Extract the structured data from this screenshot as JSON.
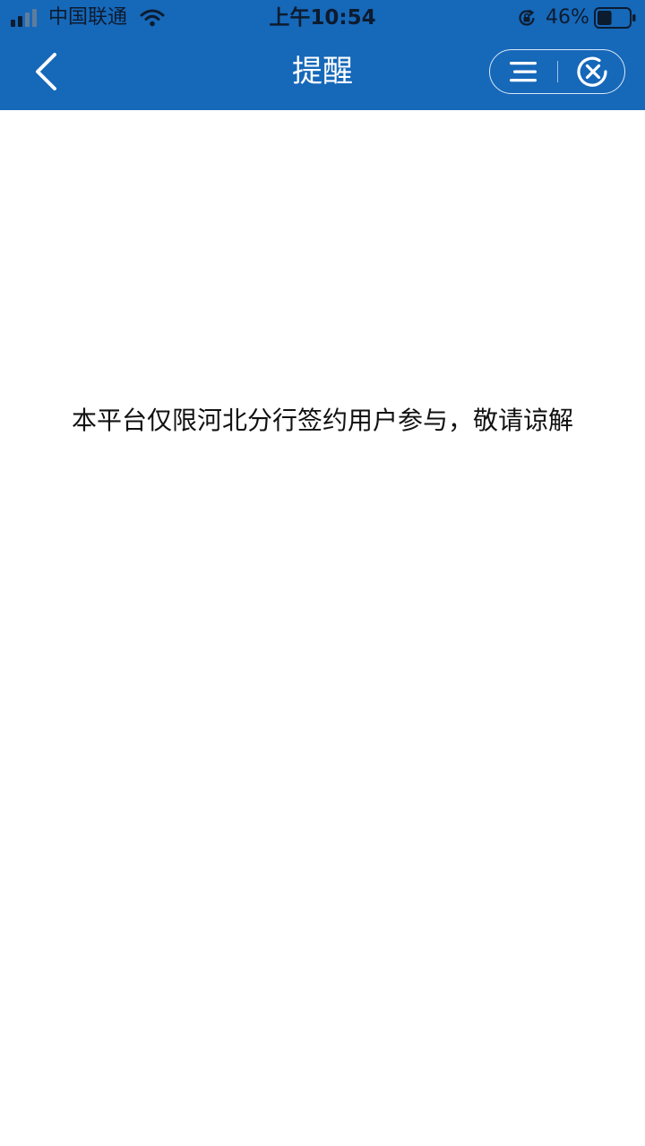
{
  "status_bar": {
    "carrier": "中国联通",
    "time": "上午10:54",
    "battery_percent": "46%",
    "battery_level": 0.46,
    "icons": [
      "signal-icon",
      "wifi-icon",
      "rotation-lock-icon",
      "battery-icon"
    ]
  },
  "nav": {
    "title": "提醒",
    "back_icon": "chevron-left-icon",
    "menu_icon": "menu-icon",
    "close_icon": "close-circle-icon"
  },
  "content": {
    "message": "本平台仅限河北分行签约用户参与，敬请谅解"
  },
  "colors": {
    "header_bg": "#1668b9",
    "status_text": "#0d1b2e",
    "title_text": "#ffffff",
    "message_text": "#111111",
    "background": "#ffffff"
  }
}
